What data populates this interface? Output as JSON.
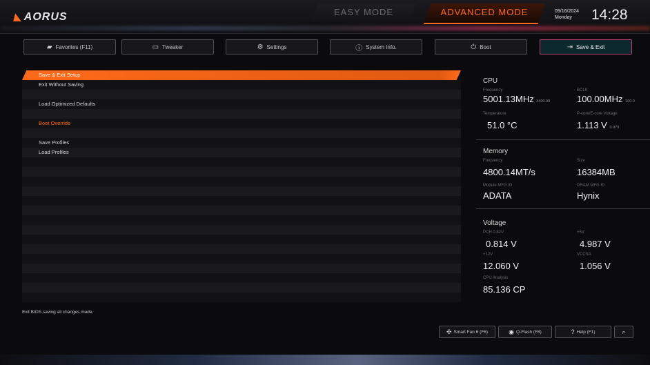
{
  "header": {
    "logo": "AORUS",
    "easy_mode": "EASY MODE",
    "advanced_mode": "ADVANCED MODE",
    "date": "09/16/2024",
    "weekday": "Monday",
    "time": "14:28"
  },
  "tabs": [
    {
      "label": "Favorites (F11)",
      "icon": "star-folder-icon"
    },
    {
      "label": "Tweaker",
      "icon": "tweaker-icon"
    },
    {
      "label": "Settings",
      "icon": "gear-icon"
    },
    {
      "label": "System Info.",
      "icon": "info-icon"
    },
    {
      "label": "Boot",
      "icon": "power-icon"
    },
    {
      "label": "Save & Exit",
      "icon": "exit-icon"
    }
  ],
  "menu": {
    "items": [
      "Save & Exit Setup",
      "Exit Without Saving",
      "",
      "Load Optimized Defaults",
      "",
      "Boot Override",
      "",
      "Save Profiles",
      "Load Profiles"
    ],
    "help_text": "Exit BIOS saving all changes made."
  },
  "cpu": {
    "title": "CPU",
    "freq_label": "Frequency",
    "freq_value": "5001.13MHz",
    "freq_note": "4400.09",
    "bclk_label": "BCLK",
    "bclk_value": "100.00MHz",
    "bclk_note": "100.0",
    "temp_label": "Temperature",
    "temp_value": "51.0 °C",
    "volt_label": "P-core/E-core Voltage",
    "volt_value": "1.113 V",
    "volt_note": "0.979"
  },
  "memory": {
    "title": "Memory",
    "freq_label": "Frequency",
    "freq_value": "4800.14MT/s",
    "size_label": "Size",
    "size_value": "16384MB",
    "module_label": "Module MFG ID",
    "module_value": "ADATA",
    "dram_label": "DRAM MFG ID",
    "dram_value": "Hynix"
  },
  "voltage": {
    "title": "Voltage",
    "pch_label": "PCH 0.82V",
    "pch_value": "0.814 V",
    "v5_label": "+5V",
    "v5_value": "4.987 V",
    "v12_label": "+12V",
    "v12_value": "12.060 V",
    "vccsa_label": "VCCSA",
    "vccsa_value": "1.056 V",
    "cpu_label": "CPU Analysis",
    "cpu_value": "85.136 CP"
  },
  "bottom_buttons": [
    {
      "label": "Smart Fan 6 (F6)",
      "icon": "fan-icon"
    },
    {
      "label": "Q-Flash (F8)",
      "icon": "qflash-icon"
    },
    {
      "label": "Help (F1)",
      "icon": "help-icon"
    },
    {
      "label": "",
      "icon": "search-icon"
    }
  ],
  "colors": {
    "accent": "#ff6a1a",
    "active_tab": "#c03a6a"
  }
}
